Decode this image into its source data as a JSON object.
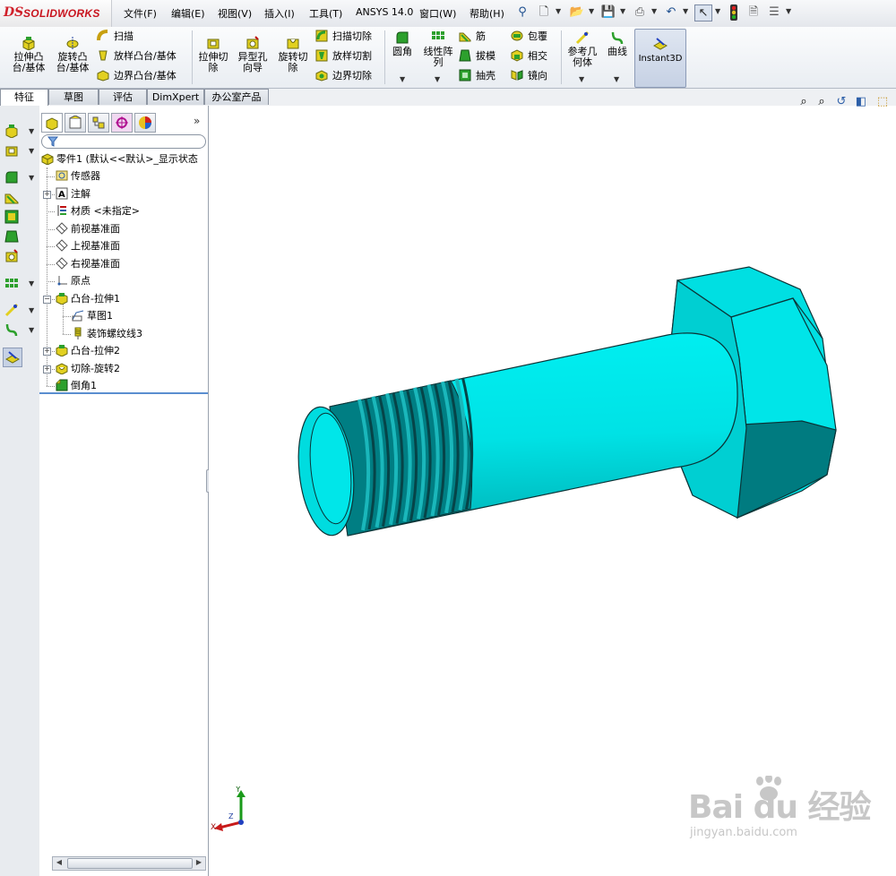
{
  "app": {
    "logo_prefix": "DS",
    "logo_text": "SOLIDWORKS"
  },
  "menu": [
    "文件(F)",
    "编辑(E)",
    "视图(V)",
    "插入(I)",
    "工具(T)",
    "ANSYS 14.0",
    "窗口(W)",
    "帮助(H)"
  ],
  "commands": {
    "extrude_boss": "拉伸凸\n台/基体",
    "revolve_boss": "旋转凸\n台/基体",
    "sweep": "扫描",
    "loft_boss": "放样凸台/基体",
    "boundary_boss": "边界凸台/基体",
    "extrude_cut": "拉伸切\n除",
    "hole_wizard": "异型孔\n向导",
    "revolve_cut": "旋转切\n除",
    "sweep_cut": "扫描切除",
    "loft_cut": "放样切割",
    "boundary_cut": "边界切除",
    "fillet": "圆角",
    "linear_pattern": "线性阵\n列",
    "rib": "筋",
    "draft": "拔模",
    "shell": "抽壳",
    "wrap": "包覆",
    "intersect": "相交",
    "mirror": "镜向",
    "ref_geometry": "参考几\n何体",
    "curves": "曲线",
    "instant3d": "Instant3D"
  },
  "tabs": [
    {
      "label": "特征",
      "active": true
    },
    {
      "label": "草图",
      "active": false
    },
    {
      "label": "评估",
      "active": false
    },
    {
      "label": "DimXpert",
      "active": false
    },
    {
      "label": "办公室产品",
      "active": false
    }
  ],
  "feature_tree": {
    "root": "零件1  (默认<<默认>_显示状态",
    "items": [
      {
        "label": "传感器",
        "icon": "sensor-icon",
        "level": 1,
        "expander": false
      },
      {
        "label": "注解",
        "icon": "annotation-icon",
        "level": 1,
        "expander": true
      },
      {
        "label": "材质 <未指定>",
        "icon": "material-icon",
        "level": 1,
        "expander": false
      },
      {
        "label": "前视基准面",
        "icon": "plane-icon",
        "level": 1,
        "expander": false
      },
      {
        "label": "上视基准面",
        "icon": "plane-icon",
        "level": 1,
        "expander": false
      },
      {
        "label": "右视基准面",
        "icon": "plane-icon",
        "level": 1,
        "expander": false
      },
      {
        "label": "原点",
        "icon": "origin-icon",
        "level": 1,
        "expander": false
      },
      {
        "label": "凸台-拉伸1",
        "icon": "extrude-icon",
        "level": 1,
        "expander": true,
        "expanded": true
      },
      {
        "label": "草图1",
        "icon": "sketch-icon",
        "level": 2,
        "expander": false
      },
      {
        "label": "装饰螺纹线3",
        "icon": "thread-icon",
        "level": 2,
        "expander": false
      },
      {
        "label": "凸台-拉伸2",
        "icon": "extrude-icon",
        "level": 1,
        "expander": true
      },
      {
        "label": "切除-旋转2",
        "icon": "revolve-cut-icon",
        "level": 1,
        "expander": true
      },
      {
        "label": "倒角1",
        "icon": "chamfer-icon",
        "level": 1,
        "expander": false
      }
    ]
  },
  "triad": {
    "x": "X",
    "y": "Y",
    "z": "Z"
  },
  "watermark": {
    "main": "Bai  du 经验",
    "sub": "jingyan.baidu.com"
  },
  "colors": {
    "part": "#00e8ea",
    "part_shade": "#00b8bc",
    "part_dark": "#006e72",
    "thread": "#0a4e52",
    "accent_blue": "#3b6fc0"
  }
}
